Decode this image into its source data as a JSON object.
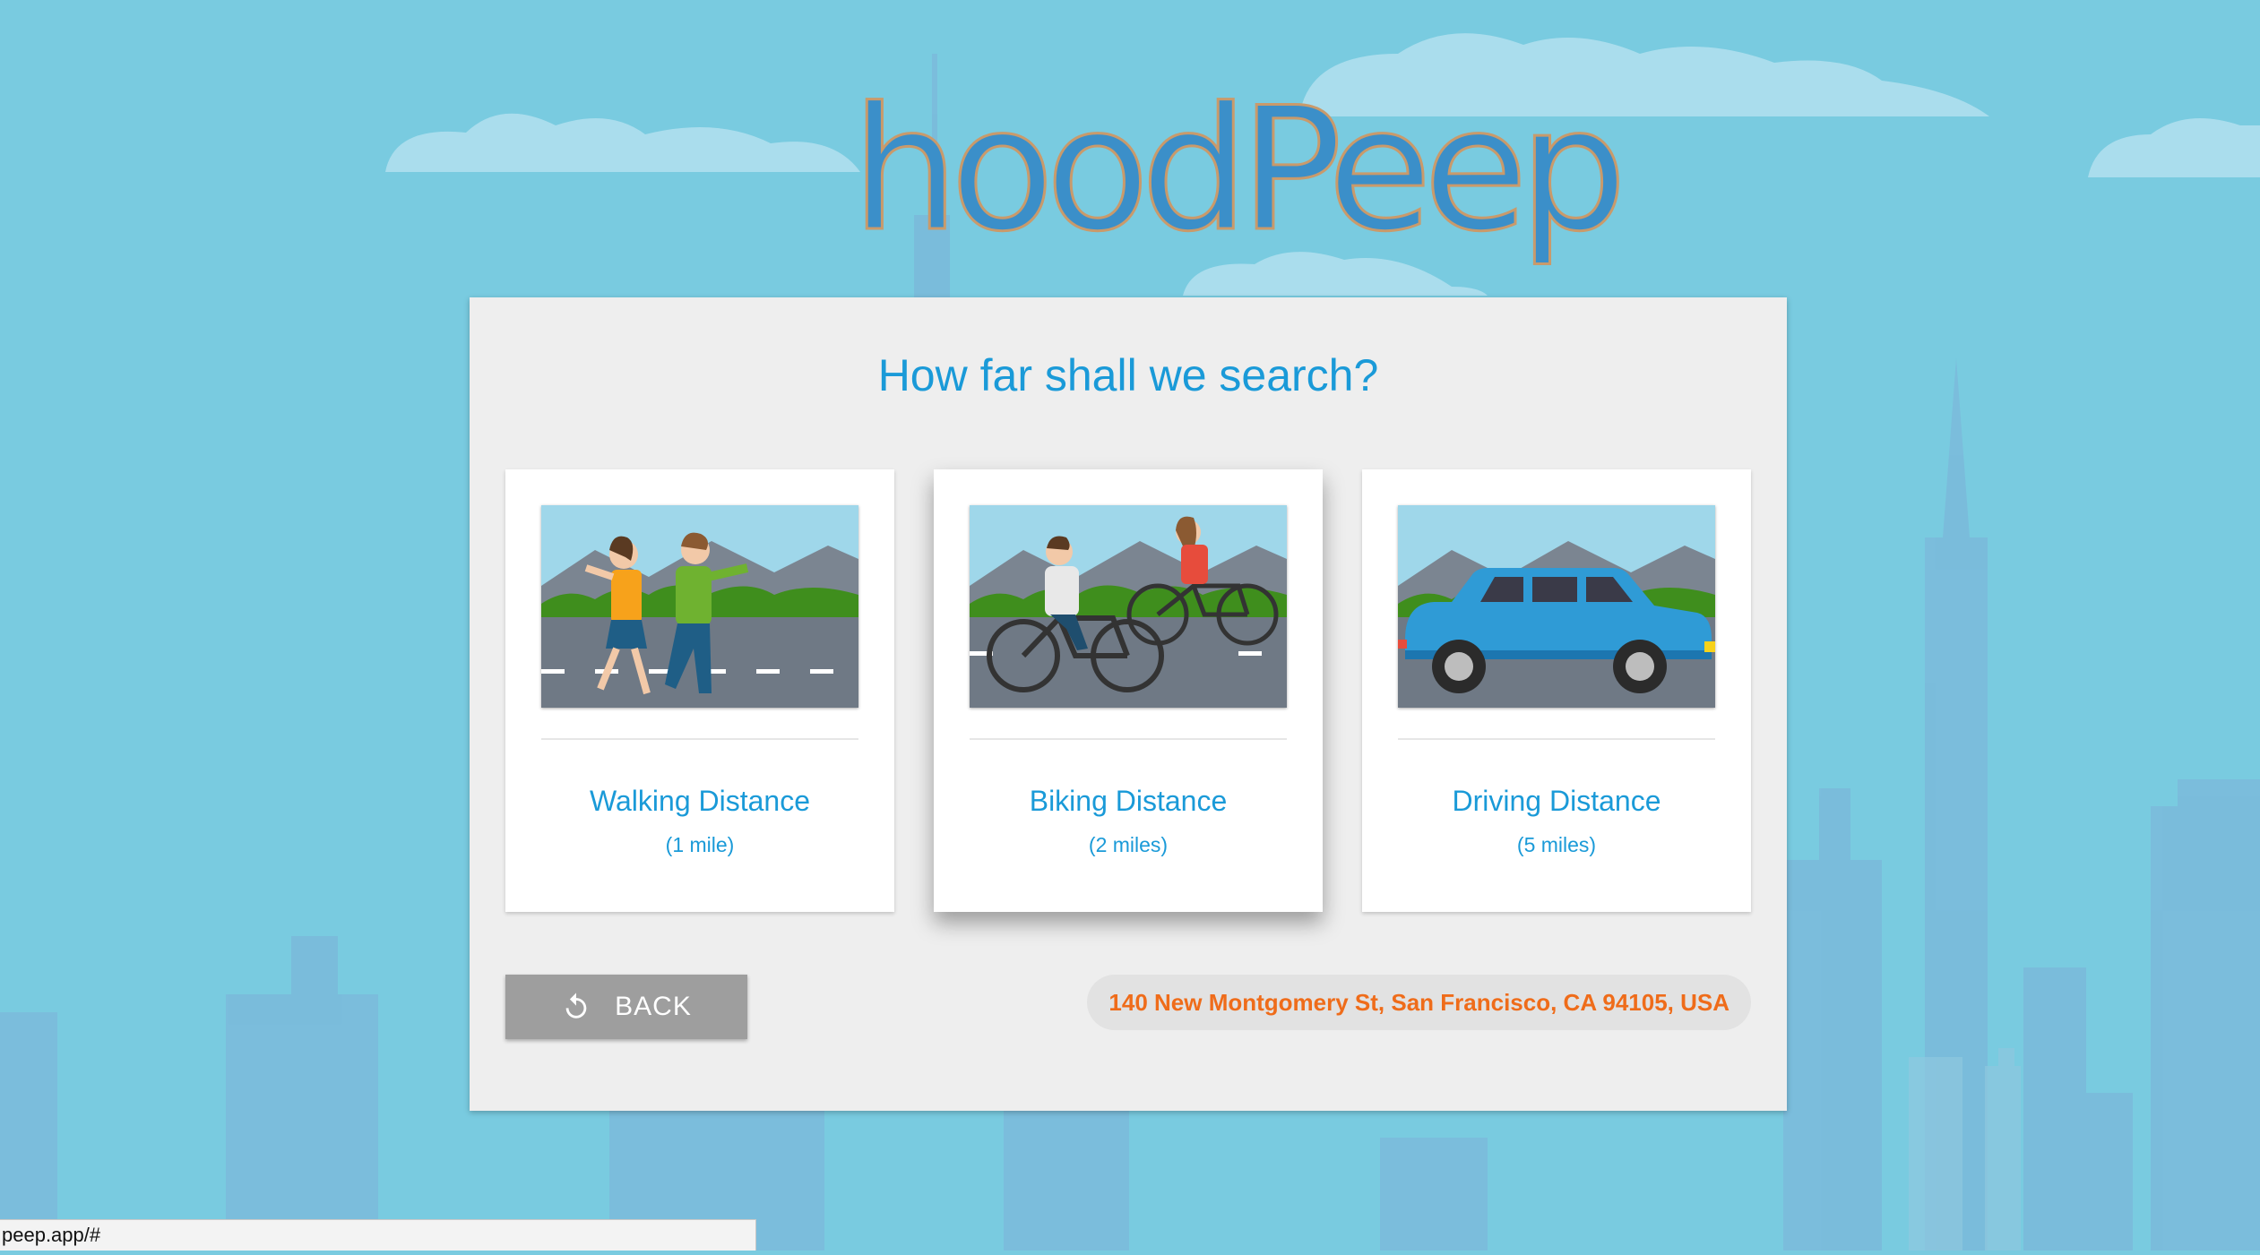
{
  "app": {
    "logo_text": "hoodPeep"
  },
  "panel": {
    "title": "How far shall we search?"
  },
  "options": [
    {
      "title": "Walking Distance",
      "subtitle": "(1 mile)",
      "image": "walking-illustration"
    },
    {
      "title": "Biking Distance",
      "subtitle": "(2 miles)",
      "image": "biking-illustration"
    },
    {
      "title": "Driving Distance",
      "subtitle": "(5 miles)",
      "image": "driving-illustration"
    }
  ],
  "back_button": {
    "label": "BACK",
    "icon": "undo-icon"
  },
  "address": "140 New Montgomery St, San Francisco, CA 94105, USA",
  "status_bar": {
    "url": "peep.app/#"
  },
  "colors": {
    "background": "#79cbe0",
    "accent": "#1a9ad8",
    "address_text": "#ef6c1a",
    "back_button": "#9e9e9e",
    "panel": "#eeeeee"
  }
}
